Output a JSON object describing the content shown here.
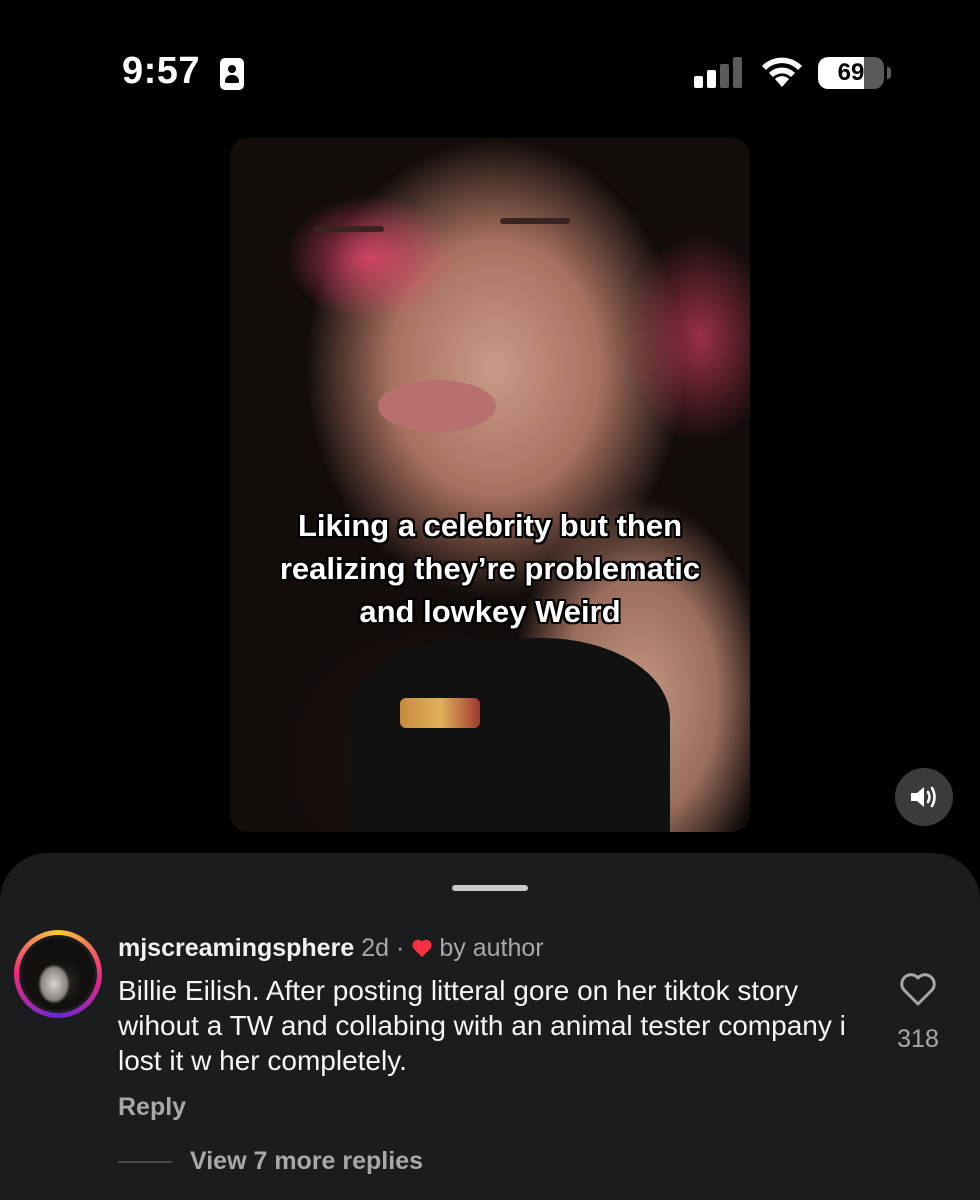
{
  "status_bar": {
    "time": "9:57",
    "battery_percent": "69",
    "battery_level": 0.69,
    "signal_bars_active": 2,
    "signal_bars_total": 4,
    "icons": [
      "focus-person-icon",
      "cellular-signal-icon",
      "wifi-icon",
      "battery-icon"
    ]
  },
  "video": {
    "caption": "Liking a celebrity but then realizing they’re problematic and lowkey Weird",
    "sound_icon": "speaker-on-icon"
  },
  "comments": {
    "items": [
      {
        "username": "mjscreamingsphere",
        "age": "2d",
        "separator": "·",
        "liked_by_author_label": "by author",
        "text": "Billie Eilish. After posting litteral gore on her tiktok story wihout a TW and collabing with an animal tester company i lost it w her completely.",
        "like_count": "318",
        "reply_label": "Reply",
        "view_replies_label": "View 7 more replies"
      }
    ]
  },
  "colors": {
    "background": "#000000",
    "sheet": "#1b1c1e",
    "secondary_text": "#a8a8aa",
    "heart_red": "#ff3040"
  }
}
